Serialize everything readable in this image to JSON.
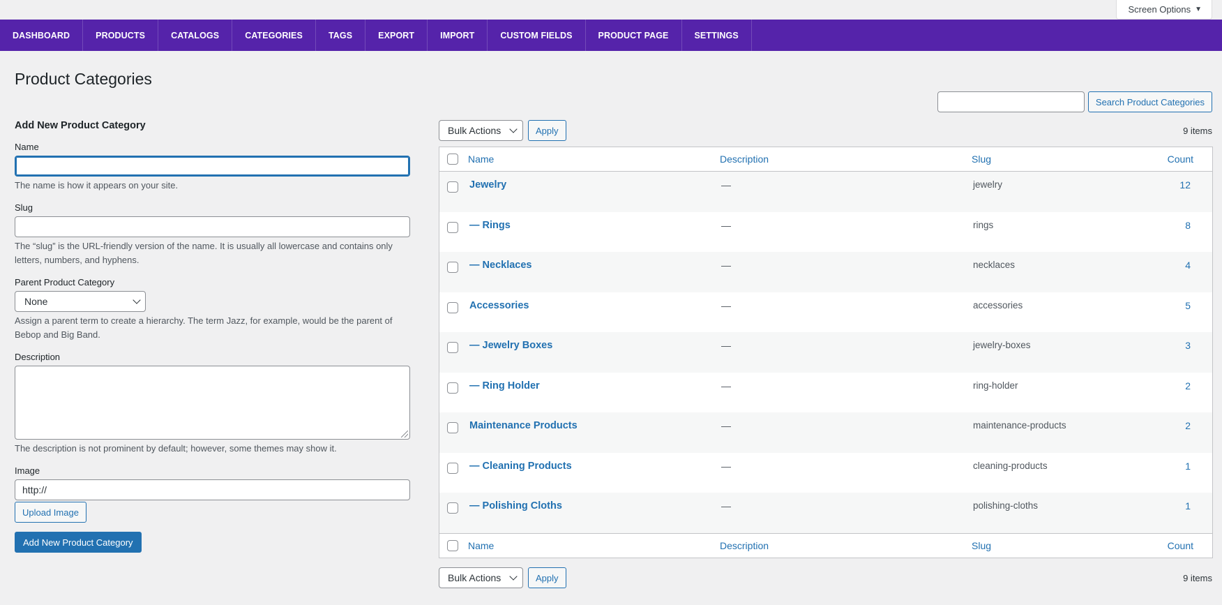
{
  "screen_options": {
    "label": "Screen Options",
    "caret": "▼"
  },
  "nav": {
    "tabs": [
      {
        "label": "DASHBOARD"
      },
      {
        "label": "PRODUCTS"
      },
      {
        "label": "CATALOGS"
      },
      {
        "label": "CATEGORIES"
      },
      {
        "label": "TAGS"
      },
      {
        "label": "EXPORT"
      },
      {
        "label": "IMPORT"
      },
      {
        "label": "CUSTOM FIELDS"
      },
      {
        "label": "PRODUCT PAGE"
      },
      {
        "label": "SETTINGS"
      }
    ]
  },
  "page": {
    "title": "Product Categories"
  },
  "form": {
    "heading": "Add New Product Category",
    "name": {
      "label": "Name",
      "value": "",
      "help": "The name is how it appears on your site."
    },
    "slug": {
      "label": "Slug",
      "value": "",
      "help": "The “slug” is the URL-friendly version of the name. It is usually all lowercase and contains only letters, numbers, and hyphens."
    },
    "parent": {
      "label": "Parent Product Category",
      "selected": "None",
      "help": "Assign a parent term to create a hierarchy. The term Jazz, for example, would be the parent of Bebop and Big Band."
    },
    "description": {
      "label": "Description",
      "value": "",
      "help": "The description is not prominent by default; however, some themes may show it."
    },
    "image": {
      "label": "Image",
      "value": "http://",
      "upload_label": "Upload Image"
    },
    "submit_label": "Add New Product Category"
  },
  "search": {
    "value": "",
    "button_label": "Search Product Categories"
  },
  "tablenav": {
    "bulk_label": "Bulk Actions",
    "apply_label": "Apply",
    "items_count": "9 items"
  },
  "table": {
    "columns": {
      "name": "Name",
      "description": "Description",
      "slug": "Slug",
      "count": "Count"
    },
    "rows": [
      {
        "name": "Jewelry",
        "description": "—",
        "slug": "jewelry",
        "count": "12"
      },
      {
        "name": "— Rings",
        "description": "—",
        "slug": "rings",
        "count": "8"
      },
      {
        "name": "— Necklaces",
        "description": "—",
        "slug": "necklaces",
        "count": "4"
      },
      {
        "name": "Accessories",
        "description": "—",
        "slug": "accessories",
        "count": "5"
      },
      {
        "name": "— Jewelry Boxes",
        "description": "—",
        "slug": "jewelry-boxes",
        "count": "3"
      },
      {
        "name": "— Ring Holder",
        "description": "—",
        "slug": "ring-holder",
        "count": "2"
      },
      {
        "name": "Maintenance Products",
        "description": "—",
        "slug": "maintenance-products",
        "count": "2"
      },
      {
        "name": "— Cleaning Products",
        "description": "—",
        "slug": "cleaning-products",
        "count": "1"
      },
      {
        "name": "— Polishing Cloths",
        "description": "—",
        "slug": "polishing-cloths",
        "count": "1"
      }
    ]
  },
  "colors": {
    "nav_bg": "#5523aa",
    "link": "#2271b1",
    "primary_button": "#2271b1"
  }
}
